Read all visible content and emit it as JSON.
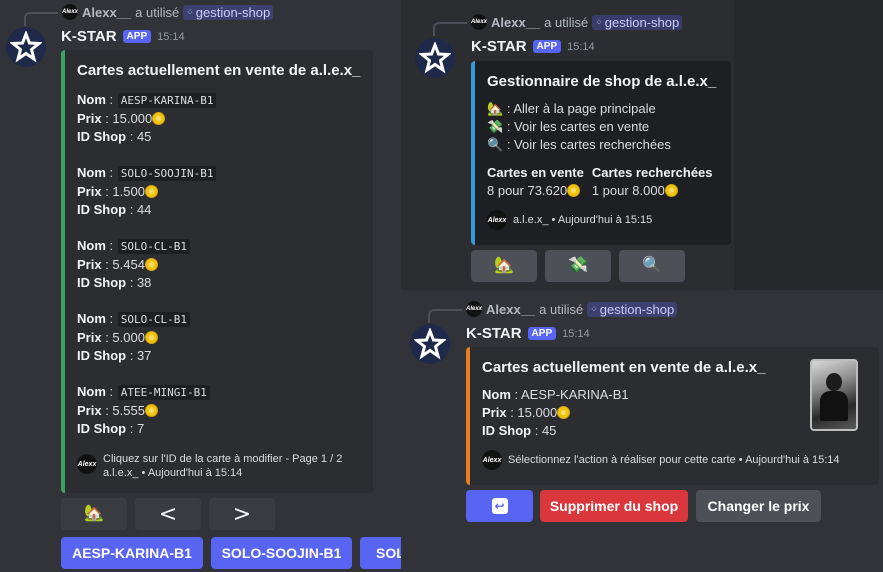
{
  "reply": {
    "user": "Alexx__",
    "action": "a utilisé",
    "command": "gestion-shop",
    "mini_avatar_text": "Alexx"
  },
  "bot": {
    "name": "K-STAR",
    "tag": "APP",
    "time": "15:14"
  },
  "left": {
    "embed_title": "Cartes actuellement en vente de a.l.e.x_",
    "labels": {
      "name": "Nom",
      "price": "Prix",
      "shop_id": "ID Shop"
    },
    "cards": [
      {
        "name": "AESP-KARINA-B1",
        "price": "15.000",
        "shop_id": "45"
      },
      {
        "name": "SOLO-SOOJIN-B1",
        "price": "1.500",
        "shop_id": "44"
      },
      {
        "name": "SOLO-CL-B1",
        "price": "5.454",
        "shop_id": "38"
      },
      {
        "name": "SOLO-CL-B1",
        "price": "5.000",
        "shop_id": "37"
      },
      {
        "name": "ATEE-MINGI-B1",
        "price": "5.555",
        "shop_id": "7"
      }
    ],
    "footer_line1": "Cliquez sur l'ID de la carte à modifier - Page 1 / 2",
    "footer_line2": "a.l.e.x_ • Aujourd'hui à 15:14",
    "nav_buttons": {
      "home_icon": "🏡",
      "prev": "<",
      "next": ">"
    },
    "id_buttons": [
      "AESP-KARINA-B1",
      "SOLO-SOOJIN-B1",
      "SOLO"
    ]
  },
  "top_right": {
    "embed_title": "Gestionnaire de shop de a.l.e.x_",
    "menu": [
      {
        "icon": "🏡",
        "text": ": Aller à la page principale"
      },
      {
        "icon": "💸",
        "text": ": Voir les cartes en vente"
      },
      {
        "icon": "🔍",
        "text": ": Voir les cartes recherchées"
      }
    ],
    "stats": [
      {
        "label": "Cartes en vente",
        "value": "8 pour 73.620"
      },
      {
        "label": "Cartes recherchées",
        "value": "1 pour 8.000"
      }
    ],
    "footer": "a.l.e.x_ • Aujourd'hui à 15:15",
    "buttons": [
      "🏡",
      "💸",
      "🔍"
    ]
  },
  "bottom_right": {
    "embed_title": "Cartes actuellement en vente de a.l.e.x_",
    "card": {
      "name": "AESP-KARINA-B1",
      "price": "15.000",
      "shop_id": "45"
    },
    "footer": "Sélectionnez l'action à réaliser pour cette carte • Aujourd'hui à 15:14",
    "buttons": {
      "back_icon": "↩",
      "remove": "Supprimer du shop",
      "change_price": "Changer le prix"
    }
  }
}
